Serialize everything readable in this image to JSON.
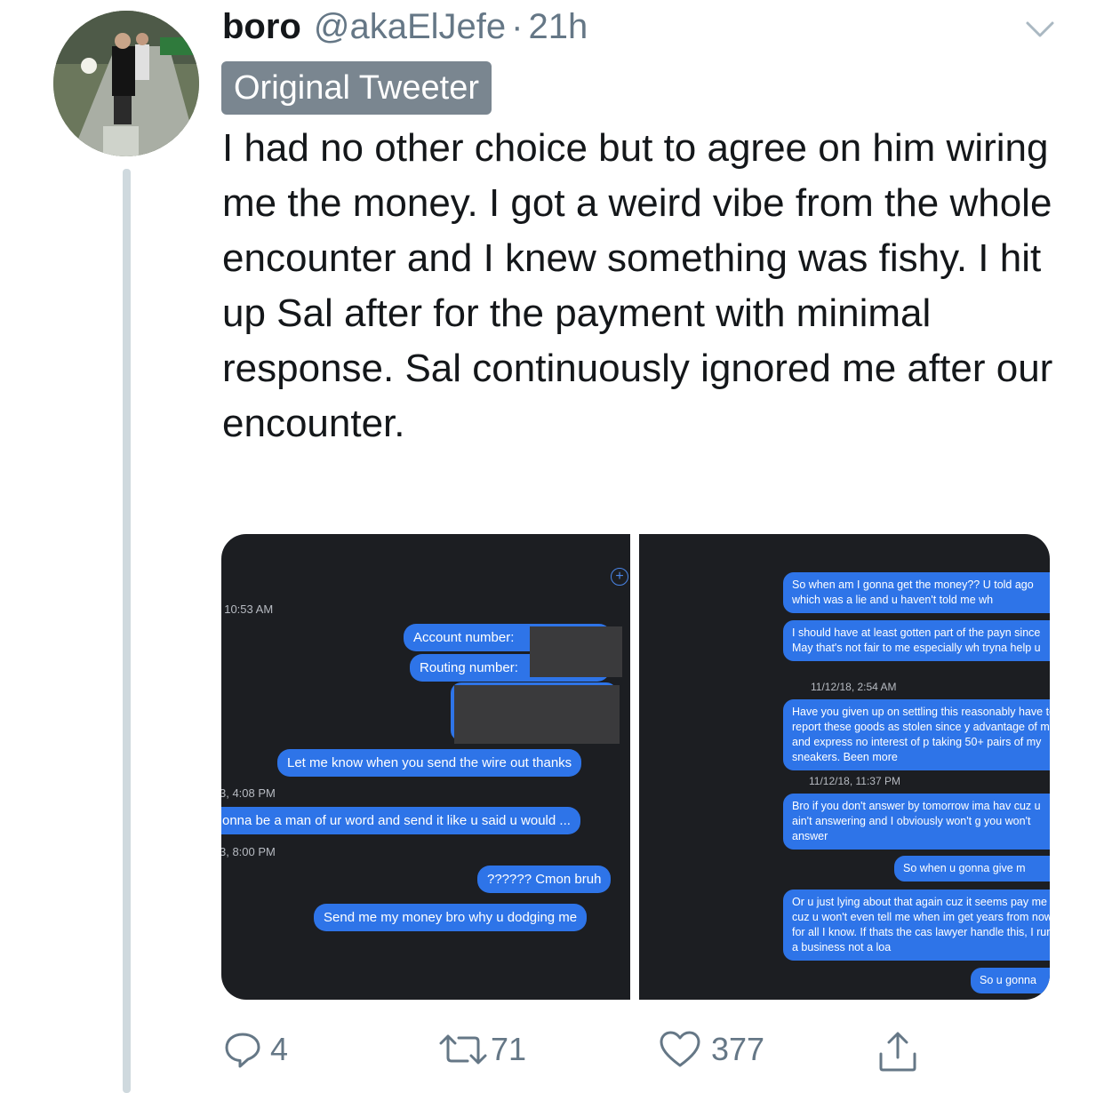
{
  "tweet": {
    "display_name": "boro",
    "handle": "@akaElJefe",
    "separator": "·",
    "time": "21h",
    "badge": "Original Tweeter",
    "text": "I had no other choice but to agree on him wiring me the money.  I got a weird vibe from the whole encounter and I knew something was fishy. I hit up Sal after for the payment with minimal response. Sal continuously ignored me after our encounter."
  },
  "left_screenshot": {
    "ts1": ", 10:53 AM",
    "account_label": "Account number:",
    "routing_label": "Routing number:",
    "msg_wire": "Let me know when you send the wire out thanks",
    "ts2": "3, 4:08 PM",
    "msg_man": "onna be a man of ur word and send it like u said u would ...",
    "ts3": "3, 8:00 PM",
    "msg_cmon": "?????? Cmon bruh",
    "msg_dodging": "Send me my money bro why u dodging me"
  },
  "right_screenshot": {
    "msg1": "So when am I gonna get the money?? U told ago which was a lie and u haven't told me wh",
    "msg2": "I should have at least gotten part of the payn since May that's not fair to me especially wh tryna help u",
    "ts1": "11/12/18, 2:54 AM",
    "msg3": "Have you given up on settling this reasonably have to report these goods as stolen since y advantage of me and express no interest of p taking 50+ pairs of my sneakers. Been more",
    "ts2": "11/12/18, 11:37 PM",
    "msg4": "Bro if you don't answer by tomorrow ima hav cuz u ain't answering and I obviously won't g you won't answer",
    "msg5": "So when u gonna give m",
    "msg6": "Or u just lying about that again cuz it seems pay me cuz u won't even tell me when im get years from now for all I know. If thats the cas lawyer handle this, I run a business not a loa",
    "msg7": "So u gonna"
  },
  "actions": {
    "reply_count": "4",
    "retweet_count": "71",
    "like_count": "377"
  },
  "icons": [
    "chevron-down-icon",
    "add-icon",
    "reply-icon",
    "retweet-icon",
    "like-icon",
    "share-icon"
  ],
  "colors": {
    "text": "#14171a",
    "secondary": "#657786",
    "badge_bg": "#7a8690",
    "imessage_blue": "#2e74e8",
    "dark_bg": "#1c1e22",
    "thread_line": "#cfd9de"
  }
}
